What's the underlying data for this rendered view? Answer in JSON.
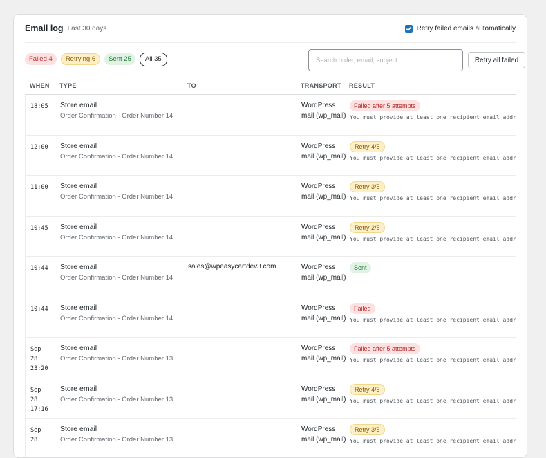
{
  "header": {
    "title": "Email log",
    "subtitle": "Last 30 days",
    "retry_auto_label": "Retry failed emails automatically",
    "retry_auto_checked": true
  },
  "filters": [
    {
      "label": "Failed 4",
      "status": "failed"
    },
    {
      "label": "Retrying 6",
      "status": "retrying"
    },
    {
      "label": "Sent 25",
      "status": "sent"
    },
    {
      "label": "All 35",
      "status": "all",
      "active": true
    }
  ],
  "search": {
    "placeholder": "Search order, email, subject..."
  },
  "retry_all_label": "Retry all failed",
  "columns": {
    "when": "WHEN",
    "type": "TYPE",
    "to": "TO",
    "transport": "TRANSPORT",
    "result": "RESULT"
  },
  "rows": [
    {
      "when": "18:05",
      "type": "Store email",
      "subject": "Order Confirmation - Order Number 14",
      "to": "",
      "transport": "WordPress mail (wp_mail)",
      "result": "Failed after 5 attempts",
      "result_kind": "failed",
      "error": "You must provide at least one recipient email address."
    },
    {
      "when": "12:00",
      "type": "Store email",
      "subject": "Order Confirmation - Order Number 14",
      "to": "",
      "transport": "WordPress mail (wp_mail)",
      "result": "Retry 4/5",
      "result_kind": "retry",
      "error": "You must provide at least one recipient email address."
    },
    {
      "when": "11:00",
      "type": "Store email",
      "subject": "Order Confirmation - Order Number 14",
      "to": "",
      "transport": "WordPress mail (wp_mail)",
      "result": "Retry 3/5",
      "result_kind": "retry",
      "error": "You must provide at least one recipient email address."
    },
    {
      "when": "10:45",
      "type": "Store email",
      "subject": "Order Confirmation - Order Number 14",
      "to": "",
      "transport": "WordPress mail (wp_mail)",
      "result": "Retry 2/5",
      "result_kind": "retry",
      "error": "You must provide at least one recipient email address."
    },
    {
      "when": "10:44",
      "type": "Store email",
      "subject": "Order Confirmation - Order Number 14",
      "to": "sales@wpeasycartdev3.com",
      "transport": "WordPress mail (wp_mail)",
      "result": "Sent",
      "result_kind": "sent",
      "error": ""
    },
    {
      "when": "10:44",
      "type": "Store email",
      "subject": "Order Confirmation - Order Number 14",
      "to": "",
      "transport": "WordPress mail (wp_mail)",
      "result": "Failed",
      "result_kind": "failed",
      "error": "You must provide at least one recipient email address."
    },
    {
      "when": "Sep\n28\n23:20",
      "type": "Store email",
      "subject": "Order Confirmation - Order Number 13",
      "to": "",
      "transport": "WordPress mail (wp_mail)",
      "result": "Failed after 5 attempts",
      "result_kind": "failed",
      "error": "You must provide at least one recipient email address."
    },
    {
      "when": "Sep\n28\n17:16",
      "type": "Store email",
      "subject": "Order Confirmation - Order Number 13",
      "to": "",
      "transport": "WordPress mail (wp_mail)",
      "result": "Retry 4/5",
      "result_kind": "retry",
      "error": "You must provide at least one recipient email address."
    },
    {
      "when": "Sep\n28",
      "type": "Store email",
      "subject": "Order Confirmation - Order Number 13",
      "to": "",
      "transport": "WordPress mail (wp_mail)",
      "result": "Retry 3/5",
      "result_kind": "retry",
      "error": "You must provide at least one recipient email address."
    }
  ]
}
